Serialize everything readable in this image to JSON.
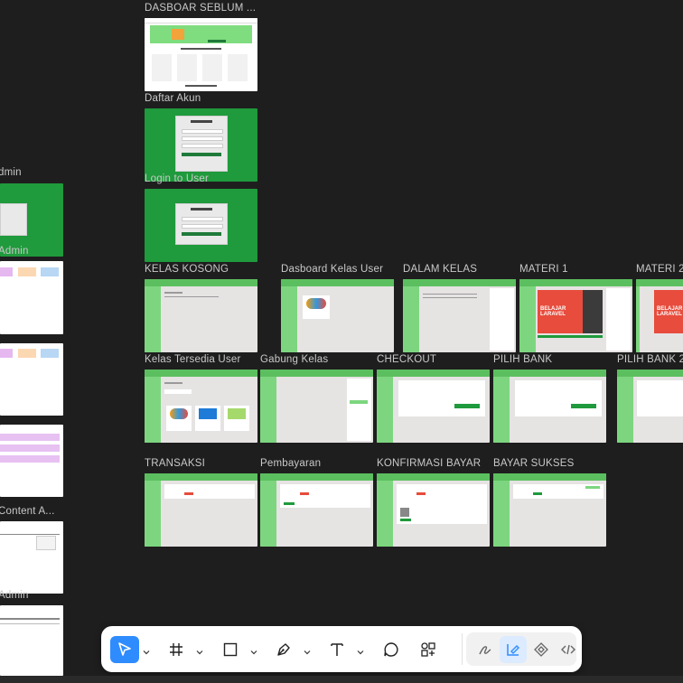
{
  "frames": {
    "dashboard_before": "DASBOAR SEBLUM ...",
    "register": "Daftar Akun",
    "login_user": "Login to User",
    "admin_partial_1": "dmin",
    "admin_partial_2": "Admin",
    "content_partial": "Content A...",
    "admin_partial_3": "Admin",
    "class_empty": "KELAS KOSONG",
    "dashboard_class_user": "Dasboard Kelas User",
    "in_class": "DALAM KELAS",
    "material_1": "MATERI 1",
    "material_2": "MATERI 2",
    "available_class_user": "Kelas Tersedia User",
    "join_class": "Gabung Kelas",
    "checkout": "CHECKOUT",
    "choose_bank": "PILIH BANK",
    "choose_bank_2": "PILIH BANK 2",
    "transaction": "TRANSAKSI",
    "payment": "Pembayaran",
    "confirm_payment": "KONFIRMASI BAYAR",
    "payment_success": "BAYAR SUKSES"
  },
  "thumb_text": {
    "brand": "Code Ey!",
    "login_title": "Code it Y",
    "belajar_laravel": "BELAJAR LARAVEL"
  },
  "toolbar": {
    "tools": [
      "move-tool",
      "frame-tool",
      "shape-tool",
      "pen-tool",
      "text-tool",
      "comment-tool",
      "actions-tool"
    ],
    "modes": [
      "draw-mode",
      "design-mode",
      "prototype-mode",
      "dev-mode"
    ]
  },
  "colors": {
    "canvas": "#1e1e1e",
    "accent": "#2f8cff",
    "app_green": "#5cbf5f",
    "dark_green": "#1f9a3c"
  }
}
